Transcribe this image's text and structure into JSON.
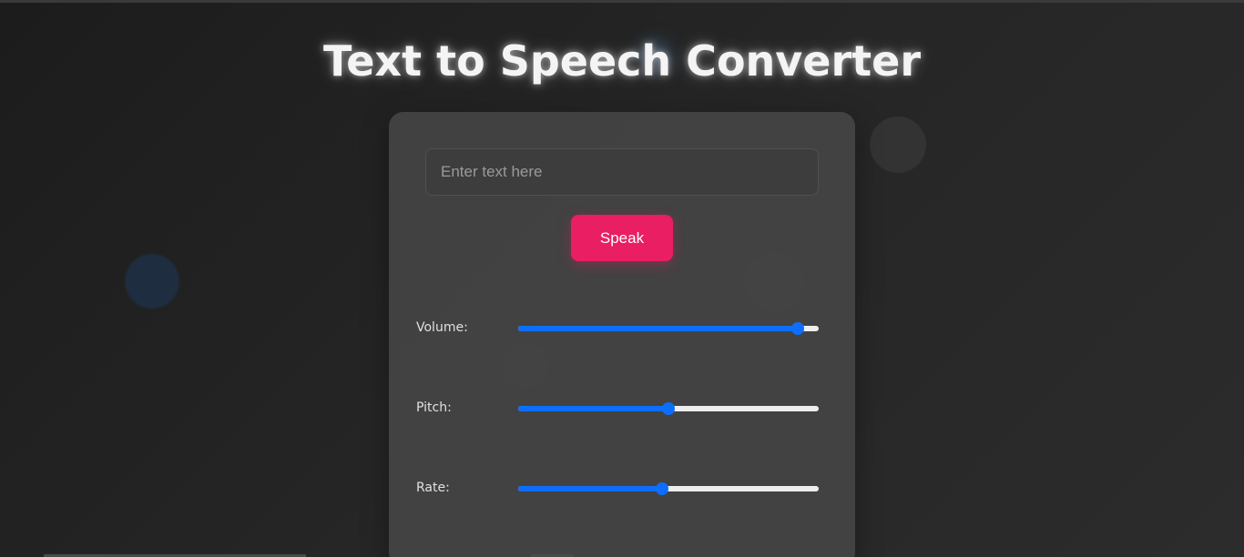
{
  "header": {
    "title": "Text to Speech Converter"
  },
  "input": {
    "placeholder": "Enter text here",
    "value": ""
  },
  "speak_button": {
    "label": "Speak",
    "color": "#e91e63"
  },
  "controls": {
    "volume": {
      "label": "Volume:",
      "level": 0.93
    },
    "pitch": {
      "label": "Pitch:",
      "level": 0.5
    },
    "rate": {
      "label": "Rate:",
      "level": 0.48
    }
  },
  "colors": {
    "accent": "#0d6efd",
    "button": "#e91e63",
    "card": "#444444",
    "background": "#222222"
  }
}
